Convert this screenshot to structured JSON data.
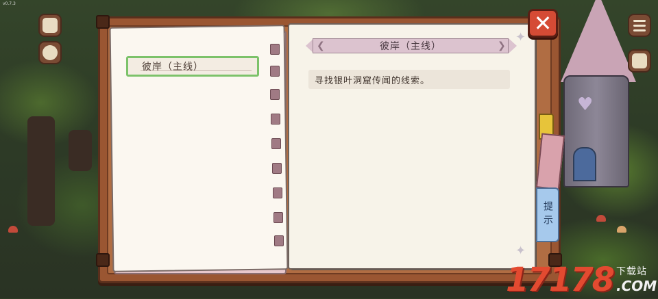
{
  "hud": {
    "version": "v0.7.3"
  },
  "quest_list": {
    "items": [
      {
        "label": "彼岸（主线）",
        "selected": true
      }
    ]
  },
  "quest_detail": {
    "title": "彼岸（主线）",
    "description": "寻找银叶洞窟传闻的线索。"
  },
  "hint_tab": {
    "label": "提示"
  },
  "close_button": {
    "symbol": "✕"
  },
  "watermark": {
    "number": "17178",
    "top_text": "下载站",
    "domain": ".COM"
  },
  "colors": {
    "frame": "#9a5632",
    "close": "#d54b35",
    "selected_border": "#7cc26a",
    "hint_tab": "#a6c9ec",
    "title_ribbon": "#dcc3cf",
    "watermark": "#e34a30"
  },
  "icons": [
    "notes-icon",
    "bag-icon",
    "menu-icon",
    "inventory-icon",
    "close-icon",
    "chevron-left-icon",
    "chevron-right-icon",
    "star-icon"
  ]
}
